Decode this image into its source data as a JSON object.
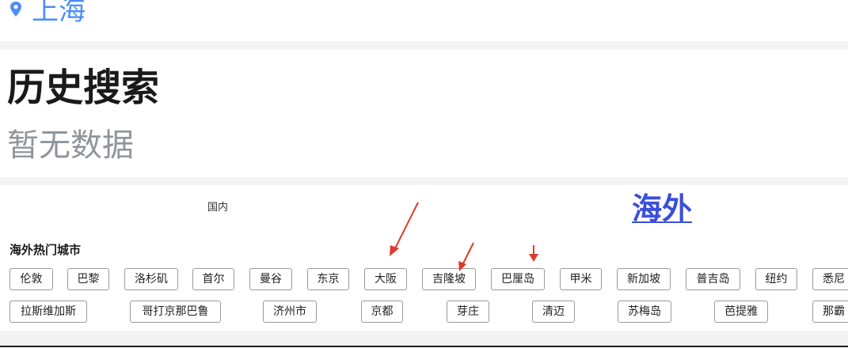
{
  "location": {
    "city": "上海",
    "icon": "location-pin-icon"
  },
  "history": {
    "title": "历史搜索",
    "empty_text": "暂无数据"
  },
  "tabs": {
    "domestic": "国内",
    "overseas": "海外"
  },
  "hot_cities": {
    "title": "海外热门城市",
    "row1": [
      "伦敦",
      "巴黎",
      "洛杉矶",
      "首尔",
      "曼谷",
      "东京",
      "大阪",
      "吉隆坡",
      "巴厘岛",
      "甲米",
      "新加坡",
      "普吉岛",
      "纽约",
      "悉尼"
    ],
    "row2": [
      "拉斯维加斯",
      "哥打京那巴鲁",
      "济州市",
      "京都",
      "芽庄",
      "清迈",
      "苏梅岛",
      "芭提雅",
      "那霸"
    ]
  },
  "colors": {
    "accent": "#4a8df8",
    "tab_active": "#3b4fd8",
    "annotation_arrow": "#e03a2e"
  }
}
